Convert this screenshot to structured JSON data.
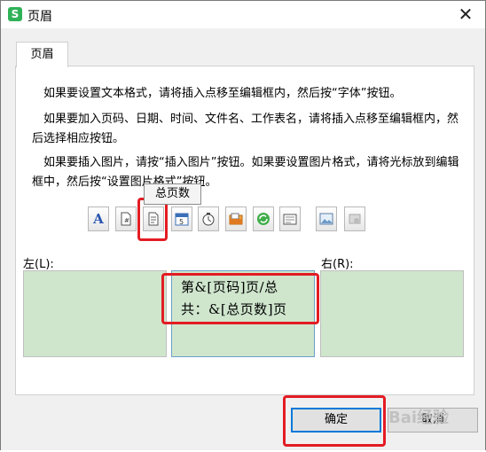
{
  "window": {
    "title": "页眉",
    "app_logo": "S",
    "close": "✕"
  },
  "tab": {
    "label": "页眉"
  },
  "instructions": [
    "如果要设置文本格式，请将插入点移至编辑框内，然后按“字体”按钮。",
    "如果要加入页码、日期、时间、文件名、工作表名，请将插入点移至编辑框内，然后选择相应按钮。",
    "如果要插入图片，请按“插入图片”按钮。如果要设置图片格式，请将光标放到编辑框中，然后按“设置图片格式”按钮。"
  ],
  "toolbar": {
    "font_button_glyph": "A",
    "icons": [
      "font-icon",
      "page-number-icon",
      "total-pages-icon",
      "date-icon",
      "time-icon",
      "file-path-icon",
      "filename-icon",
      "sheet-name-icon",
      "insert-picture-icon",
      "format-picture-icon"
    ]
  },
  "tooltip": "总页数",
  "sections": {
    "left_label": "左(L):",
    "center_text_line1": "第&[页码]页/总",
    "center_text_line2": "共：&[总页数]页",
    "right_label": "右(R):"
  },
  "buttons": {
    "ok": "确定",
    "cancel": "取消"
  },
  "watermark": "Bai经验",
  "colors": {
    "highlight": "#e31c23",
    "edit_bg": "#cfe6cd",
    "logo": "#2fb257"
  }
}
